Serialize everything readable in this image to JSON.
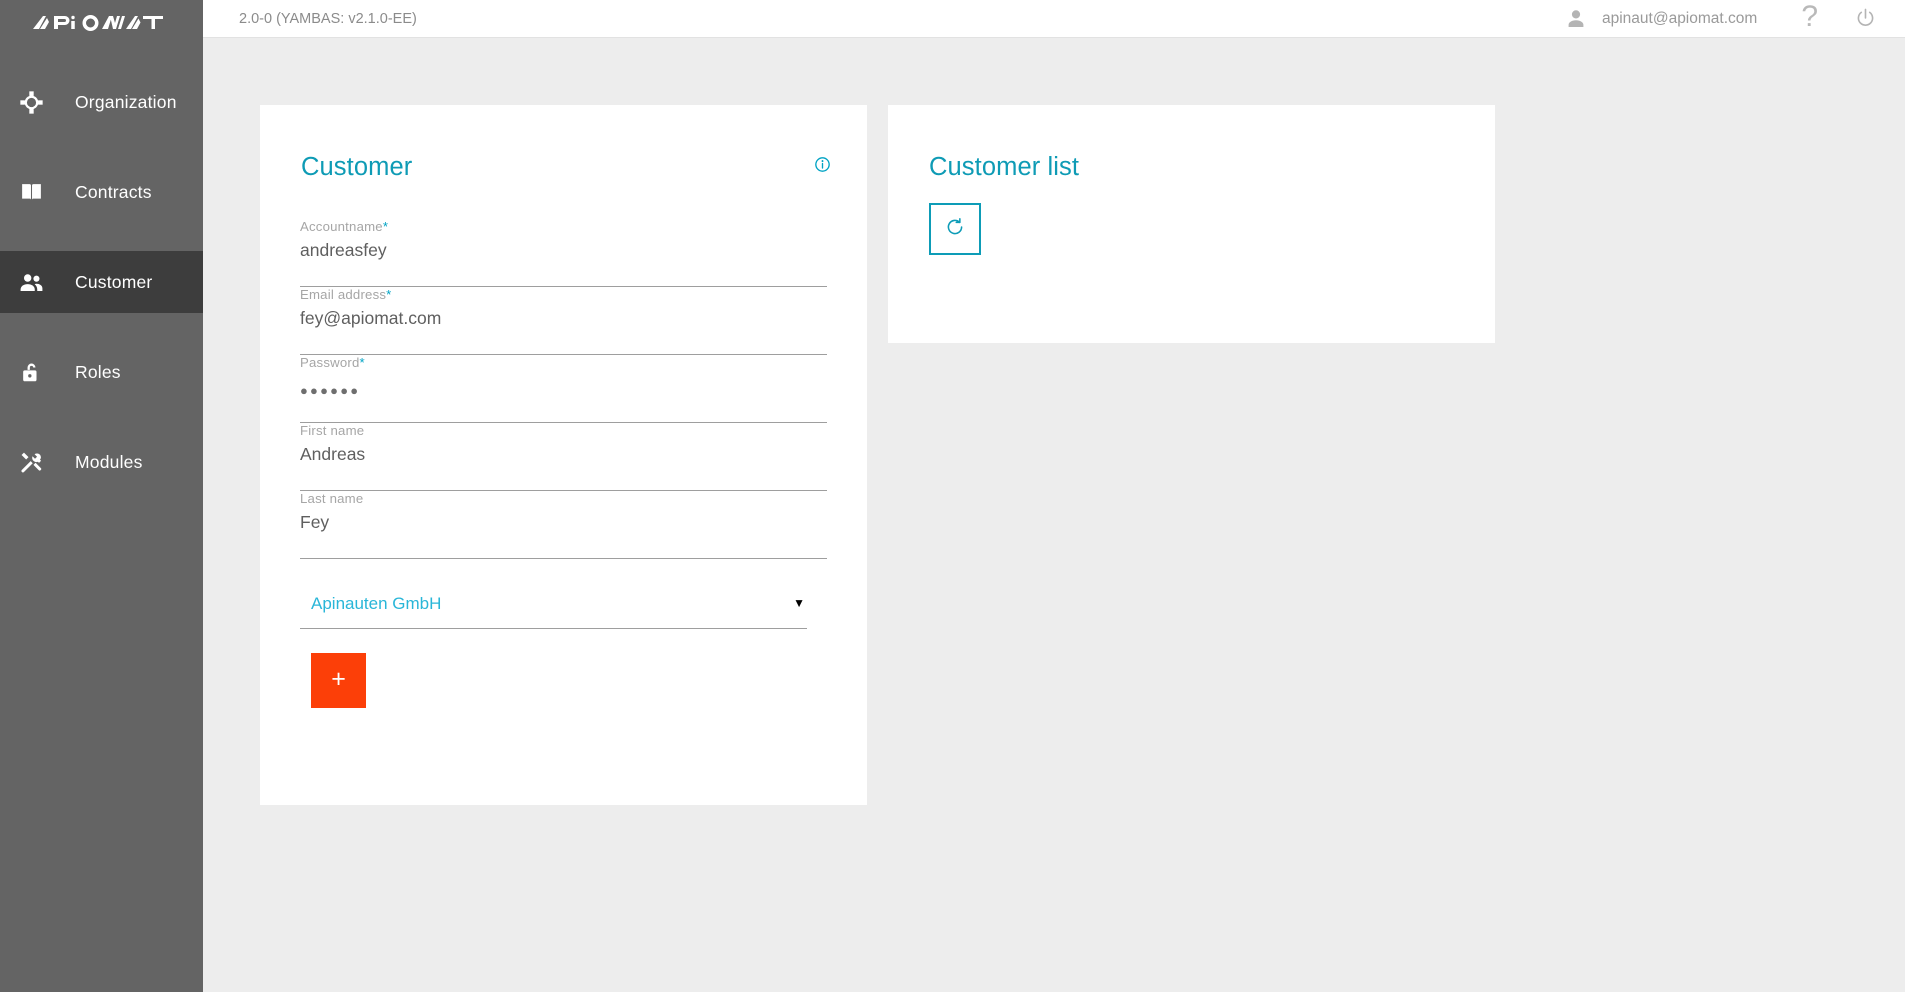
{
  "brand": {
    "name": "APIOMAT",
    "logo_icon": "apiomat-logo"
  },
  "sidebar": {
    "items": [
      {
        "label": "Organization",
        "icon": "organization-network-icon",
        "active": false
      },
      {
        "label": "Contracts",
        "icon": "open-book-icon",
        "active": false
      },
      {
        "label": "Customer",
        "icon": "people-icon",
        "active": true
      },
      {
        "label": "Roles",
        "icon": "lock-open-icon",
        "active": false
      },
      {
        "label": "Modules",
        "icon": "hammer-wrench-icon",
        "active": false
      }
    ],
    "background": "#646464",
    "active_background": "#3d3d3d"
  },
  "topbar": {
    "version": "2.0-0 (YAMBAS: v2.1.0-EE)",
    "user_email": "apinaut@apiomat.com",
    "user_icon": "person-icon",
    "help_label": "?",
    "help_icon": "question-mark-icon",
    "power_icon": "power-off-icon"
  },
  "customer_card": {
    "title": "Customer",
    "info_icon": "info-circle-icon",
    "fields": [
      {
        "label": "Accountname",
        "required": true,
        "value": "andreasfey",
        "type": "text"
      },
      {
        "label": "Email address",
        "required": true,
        "value": "fey@apiomat.com",
        "type": "text"
      },
      {
        "label": "Password",
        "required": true,
        "value": "●●●●●●",
        "type": "password"
      },
      {
        "label": "First name",
        "required": false,
        "value": "Andreas",
        "type": "text"
      },
      {
        "label": "Last name",
        "required": false,
        "value": "Fey",
        "type": "text"
      }
    ],
    "organization_select": {
      "selected": "Apinauten GmbH",
      "caret_icon": "chevron-down-icon",
      "options": [
        "Apinauten GmbH"
      ]
    },
    "add_button": {
      "label": "+",
      "icon": "plus-icon",
      "color": "#fc3f08"
    }
  },
  "customer_list_card": {
    "title": "Customer list",
    "refresh_button": {
      "icon": "refresh-icon",
      "label": ""
    },
    "rows": []
  },
  "colors": {
    "accent": "#0e9bb5",
    "accent_light": "#29b6d8",
    "orange": "#fc3f08",
    "page_background": "#ededed",
    "sidebar": "#646464"
  }
}
